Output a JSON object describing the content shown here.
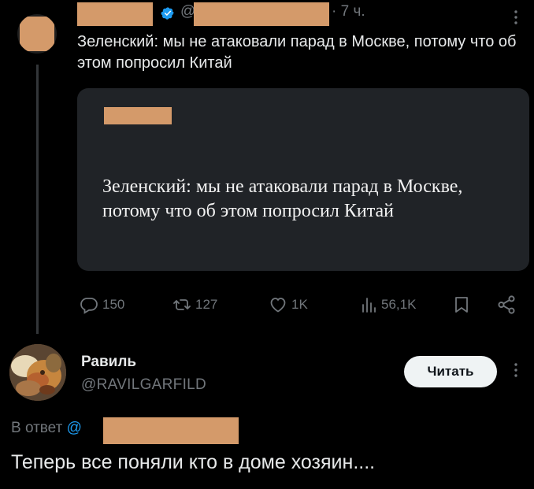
{
  "tweet": {
    "at_prefix": "@",
    "time": "· 7 ч.",
    "text": "Зеленский: мы не атаковали парад в Москве, потому что об этом попросил Китай",
    "card_text": "Зеленский: мы не атаковали парад в Москве, потому что об этом попросил Китай",
    "actions": {
      "replies": "150",
      "reposts": "127",
      "likes": "1K",
      "views": "56,1K"
    }
  },
  "reply": {
    "name": "Равиль",
    "handle": "@RAVILGARFILD",
    "follow_label": "Читать",
    "reply_to_label": "В ответ",
    "mention_prefix": "@",
    "text": "Теперь все поняли кто в доме хозяин...."
  },
  "colors": {
    "background": "#000000",
    "text": "#e7e9ea",
    "muted": "#71767b",
    "accent": "#1d9bf0",
    "redaction": "#d49a6a",
    "card": "#202327"
  }
}
